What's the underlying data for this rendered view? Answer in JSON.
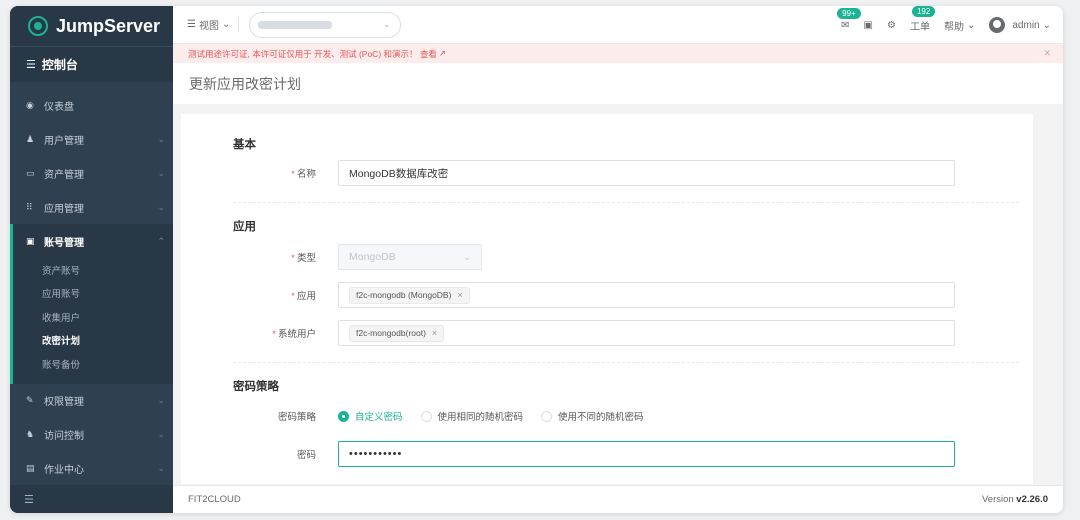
{
  "brand": {
    "name": "JumpServer"
  },
  "sidebar": {
    "console": "控制台",
    "items": [
      {
        "label": "仪表盘",
        "icon": "dashboard-icon"
      },
      {
        "label": "用户管理",
        "icon": "users-icon"
      },
      {
        "label": "资产管理",
        "icon": "assets-icon"
      },
      {
        "label": "应用管理",
        "icon": "apps-icon"
      },
      {
        "label": "账号管理",
        "icon": "account-icon"
      },
      {
        "label": "权限管理",
        "icon": "permission-icon"
      },
      {
        "label": "访问控制",
        "icon": "access-control-icon"
      },
      {
        "label": "作业中心",
        "icon": "job-center-icon"
      }
    ],
    "account_sub": [
      "资产账号",
      "应用账号",
      "收集用户",
      "改密计划",
      "账号备份"
    ]
  },
  "topbar": {
    "view": "视图",
    "mail_badge": "99+",
    "ticket": "工单",
    "ticket_badge": "192",
    "help": "帮助",
    "user": "admin"
  },
  "alert": {
    "text": "测试用途许可证, 本许可证仅用于 开发、测试 (PoC) 和演示！ 查看"
  },
  "page": {
    "title": "更新应用改密计划"
  },
  "form": {
    "section_basic": "基本",
    "name_label": "名称",
    "name_value": "MongoDB数据库改密",
    "section_app": "应用",
    "type_label": "类型",
    "type_value": "MongoDB",
    "app_label": "应用",
    "app_tag": "f2c-mongodb (MongoDB)",
    "sysuser_label": "系统用户",
    "sysuser_tag": "f2c-mongodb(root)",
    "section_policy": "密码策略",
    "policy_label": "密码策略",
    "policy_options": [
      "自定义密码",
      "使用相同的随机密码",
      "使用不同的随机密码"
    ],
    "password_label": "密码",
    "password_value": "•••••••••••"
  },
  "footer": {
    "company": "FIT2CLOUD",
    "version_prefix": "Version",
    "version": "v2.26.0"
  },
  "colors": {
    "accent": "#1ab394",
    "sidebar": "#2f4050",
    "alert_text": "#e45656"
  }
}
